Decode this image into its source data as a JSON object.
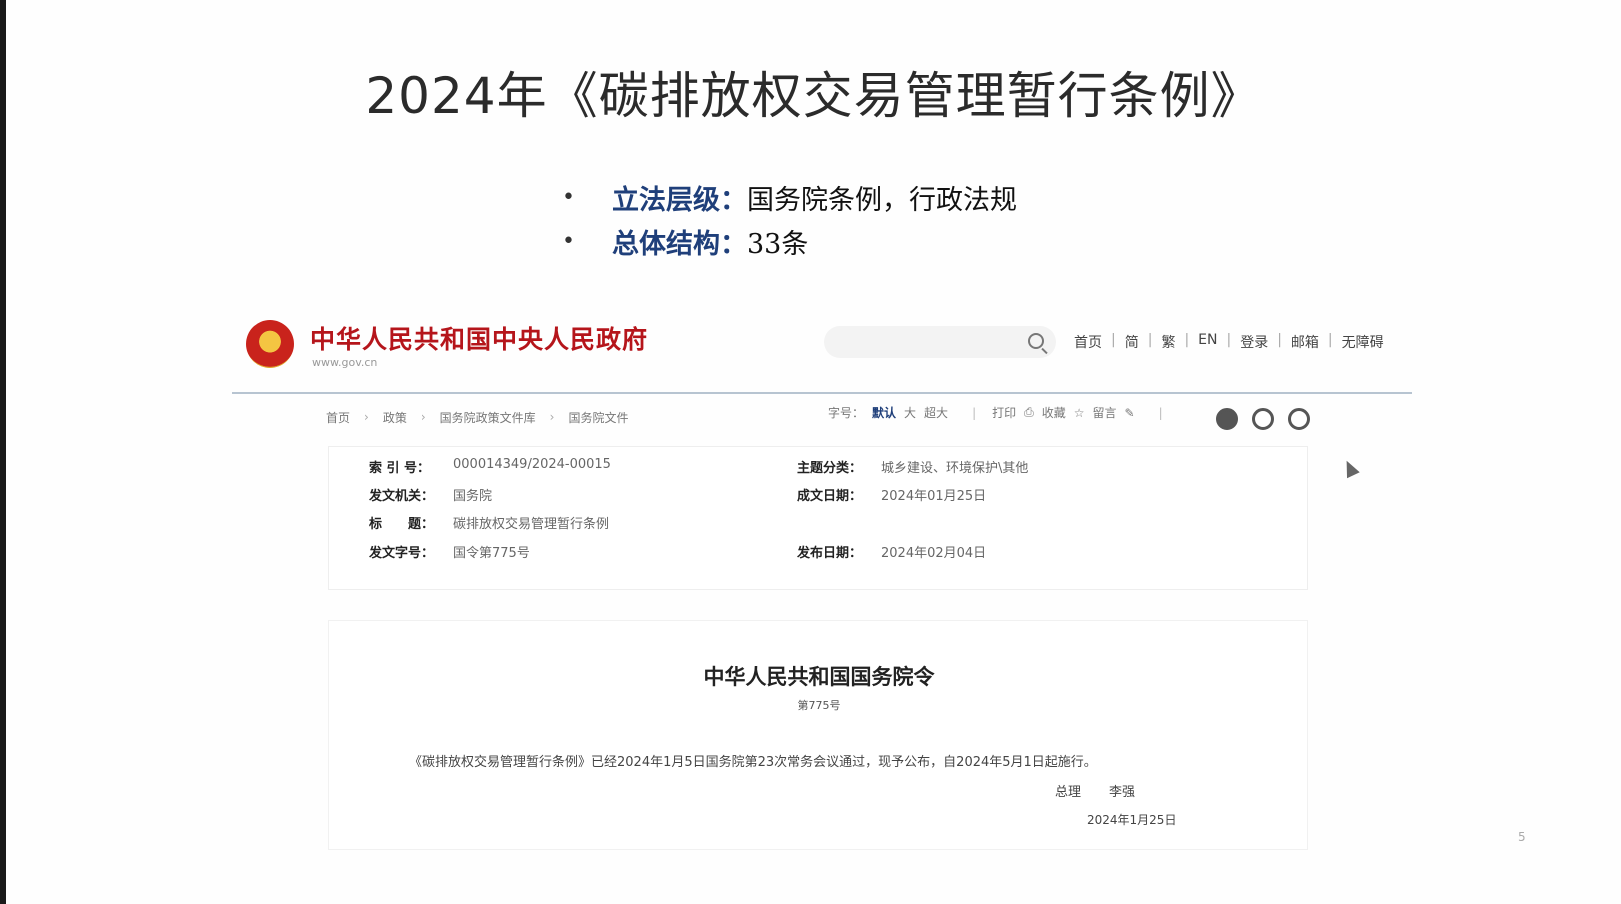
{
  "slide": {
    "title": "2024年《碳排放权交易管理暂行条例》",
    "bullets": [
      {
        "key": "立法层级：",
        "value": "国务院条例，行政法规"
      },
      {
        "key": "总体结构：",
        "value": "33条"
      }
    ],
    "page_number": "5"
  },
  "gov_site": {
    "name": "中华人民共和国中央人民政府",
    "url": "www.gov.cn",
    "search_placeholder": "",
    "top_nav": [
      "首页",
      "简",
      "繁",
      "EN",
      "登录",
      "邮箱",
      "无障碍"
    ],
    "breadcrumbs": [
      "首页",
      "政策",
      "国务院政策文件库",
      "国务院文件"
    ],
    "tools": {
      "font_label": "字号：",
      "font_default": "默认",
      "font_large": "大",
      "font_xlarge": "超大",
      "print": "打印",
      "favorite": "收藏",
      "message": "留言"
    },
    "share_icons": [
      "wechat-icon",
      "weibo-icon",
      "qzone-icon"
    ],
    "meta": {
      "index_no_label": "索 引 号：",
      "index_no": "000014349/2024-00015",
      "topic_label": "主题分类：",
      "topic": "城乡建设、环境保护\\其他",
      "issuer_label": "发文机关：",
      "issuer": "国务院",
      "written_date_label": "成文日期：",
      "written_date": "2024年01月25日",
      "title_label": "标　　题：",
      "title": "碳排放权交易管理暂行条例",
      "doc_no_label": "发文字号：",
      "doc_no": "国令第775号",
      "publish_date_label": "发布日期：",
      "publish_date": "2024年02月04日"
    },
    "document": {
      "heading": "中华人民共和国国务院令",
      "number": "第775号",
      "body": "《碳排放权交易管理暂行条例》已经2024年1月5日国务院第23次常务会议通过，现予公布，自2024年5月1日起施行。",
      "signer_title": "总理",
      "signer_name": "李强",
      "date": "2024年1月25日"
    }
  }
}
